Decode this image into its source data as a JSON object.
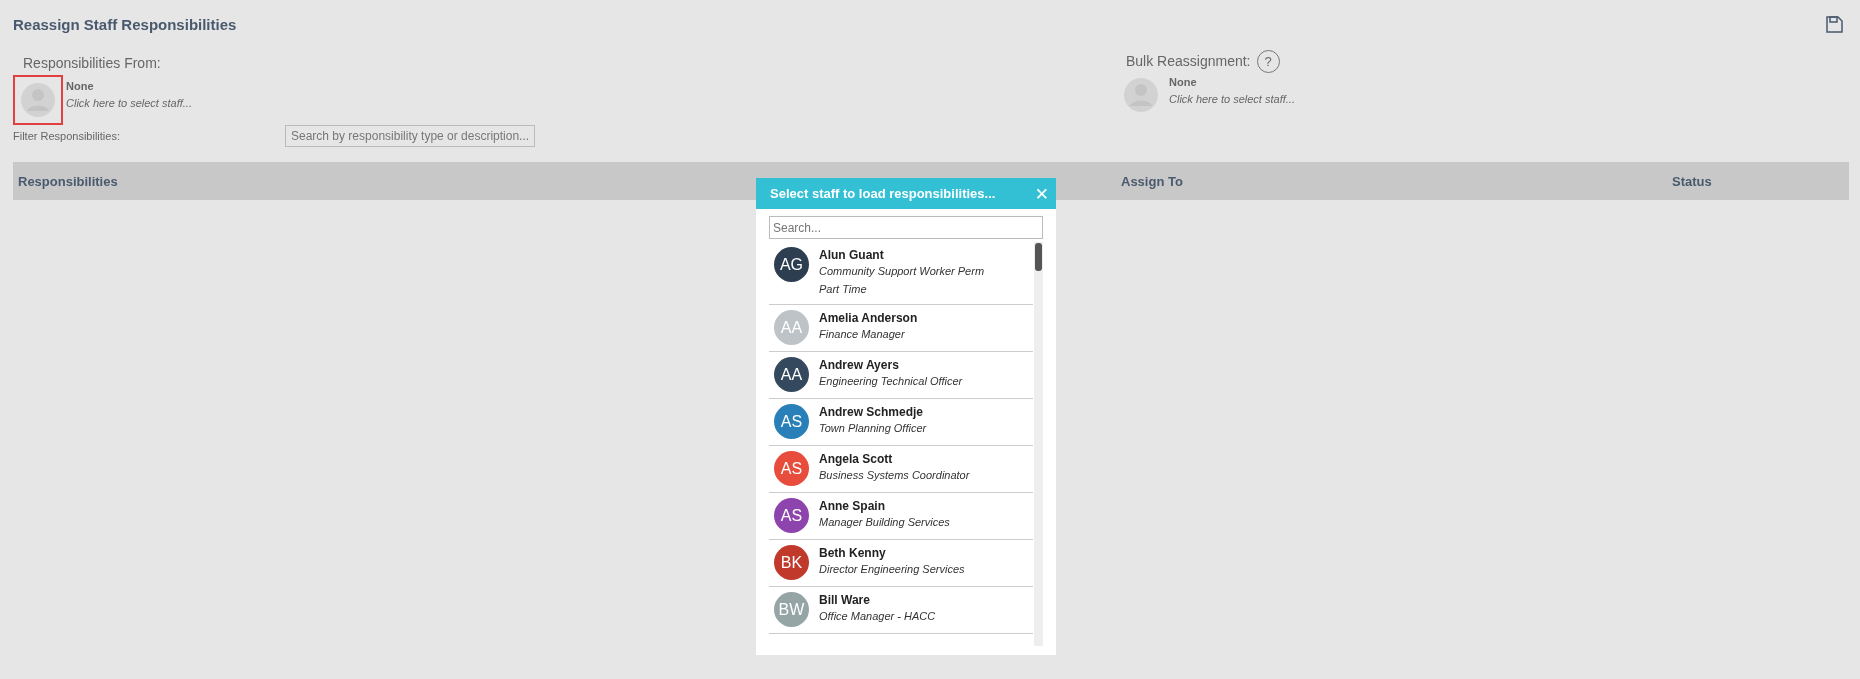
{
  "title": "Reassign Staff Responsibilities",
  "responsibilities_from": {
    "label": "Responsibilities From:",
    "name": "None",
    "hint": "Click here to select staff...",
    "invalid": true
  },
  "bulk_reassignment": {
    "label": "Bulk Reassignment:",
    "help": "?",
    "name": "None",
    "hint": "Click here to select staff...",
    "invalid": false
  },
  "filter": {
    "label": "Filter Responsibilities:",
    "placeholder": "Search by responsibility type or description..."
  },
  "table": {
    "columns": [
      "Responsibilities",
      "Assign To",
      "Status"
    ]
  },
  "dialog": {
    "title": "Select staff to load responsibilities...",
    "close": "✕",
    "search_placeholder": "Search...",
    "staff": [
      {
        "initials": "AG",
        "name": "Alun Guant",
        "role": "Community Support Worker Perm Part Time",
        "color": "#2c3e50"
      },
      {
        "initials": "AA",
        "name": "Amelia Anderson",
        "role": "Finance Manager",
        "color": "#bdc3c7"
      },
      {
        "initials": "AA",
        "name": "Andrew Ayers",
        "role": "Engineering Technical Officer",
        "color": "#34495e"
      },
      {
        "initials": "AS",
        "name": "Andrew Schmedje",
        "role": "Town Planning Officer",
        "color": "#2980b9"
      },
      {
        "initials": "AS",
        "name": "Angela Scott",
        "role": "Business Systems Coordinator",
        "color": "#e74c3c"
      },
      {
        "initials": "AS",
        "name": "Anne Spain",
        "role": "Manager Building Services",
        "color": "#8e44ad"
      },
      {
        "initials": "BK",
        "name": "Beth Kenny",
        "role": "Director Engineering Services",
        "color": "#c0392b"
      },
      {
        "initials": "BW",
        "name": "Bill Ware",
        "role": "Office Manager - HACC",
        "color": "#95a5a6"
      }
    ]
  }
}
